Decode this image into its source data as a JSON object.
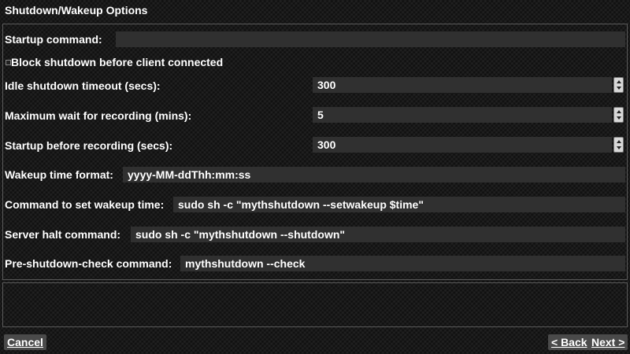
{
  "window": {
    "title": "Shutdown/Wakeup Options"
  },
  "settings": {
    "startup_command": {
      "label": "Startup command:",
      "value": ""
    },
    "block_shutdown": {
      "label": "Block shutdown before client connected",
      "checked": false
    },
    "idle_timeout": {
      "label": "Idle shutdown timeout (secs):",
      "value": "300"
    },
    "max_wait": {
      "label": "Maximum wait for recording (mins):",
      "value": "5"
    },
    "startup_before": {
      "label": "Startup before recording (secs):",
      "value": "300"
    },
    "wakeup_format": {
      "label": "Wakeup time format:",
      "value": "yyyy-MM-ddThh:mm:ss"
    },
    "set_wakeup_cmd": {
      "label": "Command to set wakeup time:",
      "value": "sudo sh -c \"mythshutdown --setwakeup $time\""
    },
    "halt_cmd": {
      "label": "Server halt command:",
      "value": "sudo sh -c \"mythshutdown --shutdown\""
    },
    "precheck_cmd": {
      "label": "Pre-shutdown-check command:",
      "value": "mythshutdown --check"
    }
  },
  "buttons": {
    "cancel": "Cancel",
    "back": "< Back",
    "next": "Next >"
  }
}
